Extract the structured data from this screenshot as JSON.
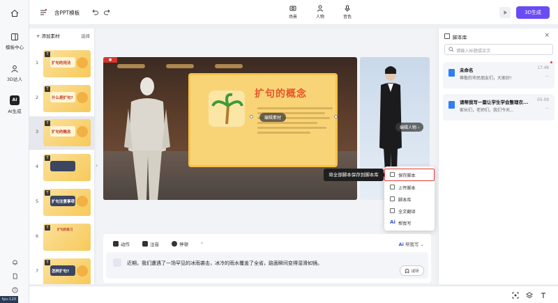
{
  "rail": {
    "items": [
      {
        "label": ""
      },
      {
        "label": "模板中心"
      },
      {
        "label": "3D达人"
      },
      {
        "label": "AI生成",
        "badge": "AI"
      }
    ],
    "fps": "fps:120"
  },
  "header": {
    "title": "含PPT模板",
    "tools": [
      {
        "label": "场景"
      },
      {
        "label": "人物"
      },
      {
        "label": "音色"
      }
    ],
    "generate_label": "3D生成"
  },
  "slides_panel": {
    "add_label": "添加素材",
    "select_label": "选择",
    "slides": [
      {
        "num": "1",
        "text": "扩句的用法"
      },
      {
        "num": "2",
        "text": "什么是扩句?"
      },
      {
        "num": "3",
        "text": "扩句的概念"
      },
      {
        "num": "4",
        "text": ""
      },
      {
        "num": "5",
        "text": "扩句注意事项"
      },
      {
        "num": "6",
        "text": "扩句的练习"
      },
      {
        "num": "7",
        "text": "怎样扩句?"
      }
    ]
  },
  "stage": {
    "slide_title": "扩句的概念",
    "edit_slide_label": "编辑素材",
    "edit_person_label": "编辑人物",
    "tooltip": "将全部脚本保存到脚本库",
    "menu": [
      {
        "label": "保存脚本",
        "icon": "save-icon"
      },
      {
        "label": "上传脚本",
        "icon": "upload-icon"
      },
      {
        "label": "脚本库",
        "icon": "library-icon"
      },
      {
        "label": "全文翻译",
        "icon": "translate-icon"
      },
      {
        "label": "帮我写",
        "icon": "ai-icon"
      }
    ]
  },
  "editor": {
    "tools": [
      {
        "label": "动作"
      },
      {
        "label": "注音"
      },
      {
        "label": "停顿"
      }
    ],
    "help_write": "帮我写",
    "script_text": "近期，我们遭遇了一场罕见的冰雨袭击，冰冷的雨水覆盖了全省，路面瞬间变得湿滑如镜。",
    "try_label": "试听"
  },
  "right_panel": {
    "title": "脚本库",
    "search_placeholder": "请输入标题或正文",
    "cards": [
      {
        "title": "未命名",
        "time": "17:48",
        "subtitle": "尊敬的市民朋友们，大家好!"
      },
      {
        "title": "请帮我写一篇让学生学会整理衣...",
        "time": "05-09",
        "subtitle": "家长们，老师们，我们今天..."
      }
    ]
  }
}
